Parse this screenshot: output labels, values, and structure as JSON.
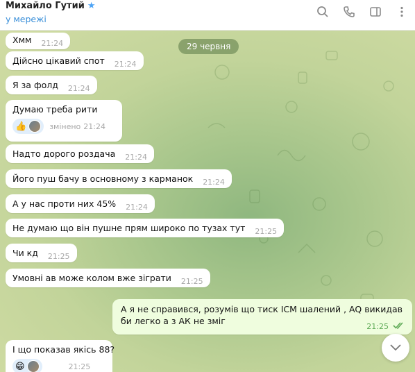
{
  "header": {
    "contact_name": "Михайло Гутий",
    "status": "у мережі",
    "icons": [
      "search-icon",
      "phone-icon",
      "sidebar-icon",
      "more-icon"
    ]
  },
  "chat": {
    "date_label": "29 червня",
    "incoming": [
      {
        "text": "Хмм",
        "time": "21:24"
      },
      {
        "text": "Дійсно цікавий спот",
        "time": "21:24"
      },
      {
        "text": "Я за фолд",
        "time": "21:24"
      },
      {
        "text": "Думаю треба рити",
        "edited": "змінено",
        "time": "21:24",
        "reaction": "👍"
      },
      {
        "text": "Надто дорого роздача",
        "time": "21:24"
      },
      {
        "text": "Його пуш бачу в основному з карманок",
        "time": "21:24"
      },
      {
        "text": "А у нас проти них 45%",
        "time": "21:24"
      },
      {
        "text": "Не думаю що він пушне прям широко по тузах тут",
        "time": "21:25"
      },
      {
        "text": "Чи кд",
        "time": "21:25"
      },
      {
        "text": "Умовні ав може колом вже зіграти",
        "time": "21:25"
      },
      {
        "text": "І що показав якісь 88?",
        "time": "21:25",
        "reaction": "😁"
      }
    ],
    "outgoing": {
      "text": "А я не справився,  розумів що тиск ICM шалений , AQ викидав би легко а з АК не зміг",
      "time": "21:25",
      "status_icon": "double-check-icon"
    }
  },
  "colors": {
    "accent": "#3a8fd9",
    "outgoing_bubble": "#effdde",
    "incoming_bubble": "#ffffff",
    "check_color": "#5eaa56"
  }
}
